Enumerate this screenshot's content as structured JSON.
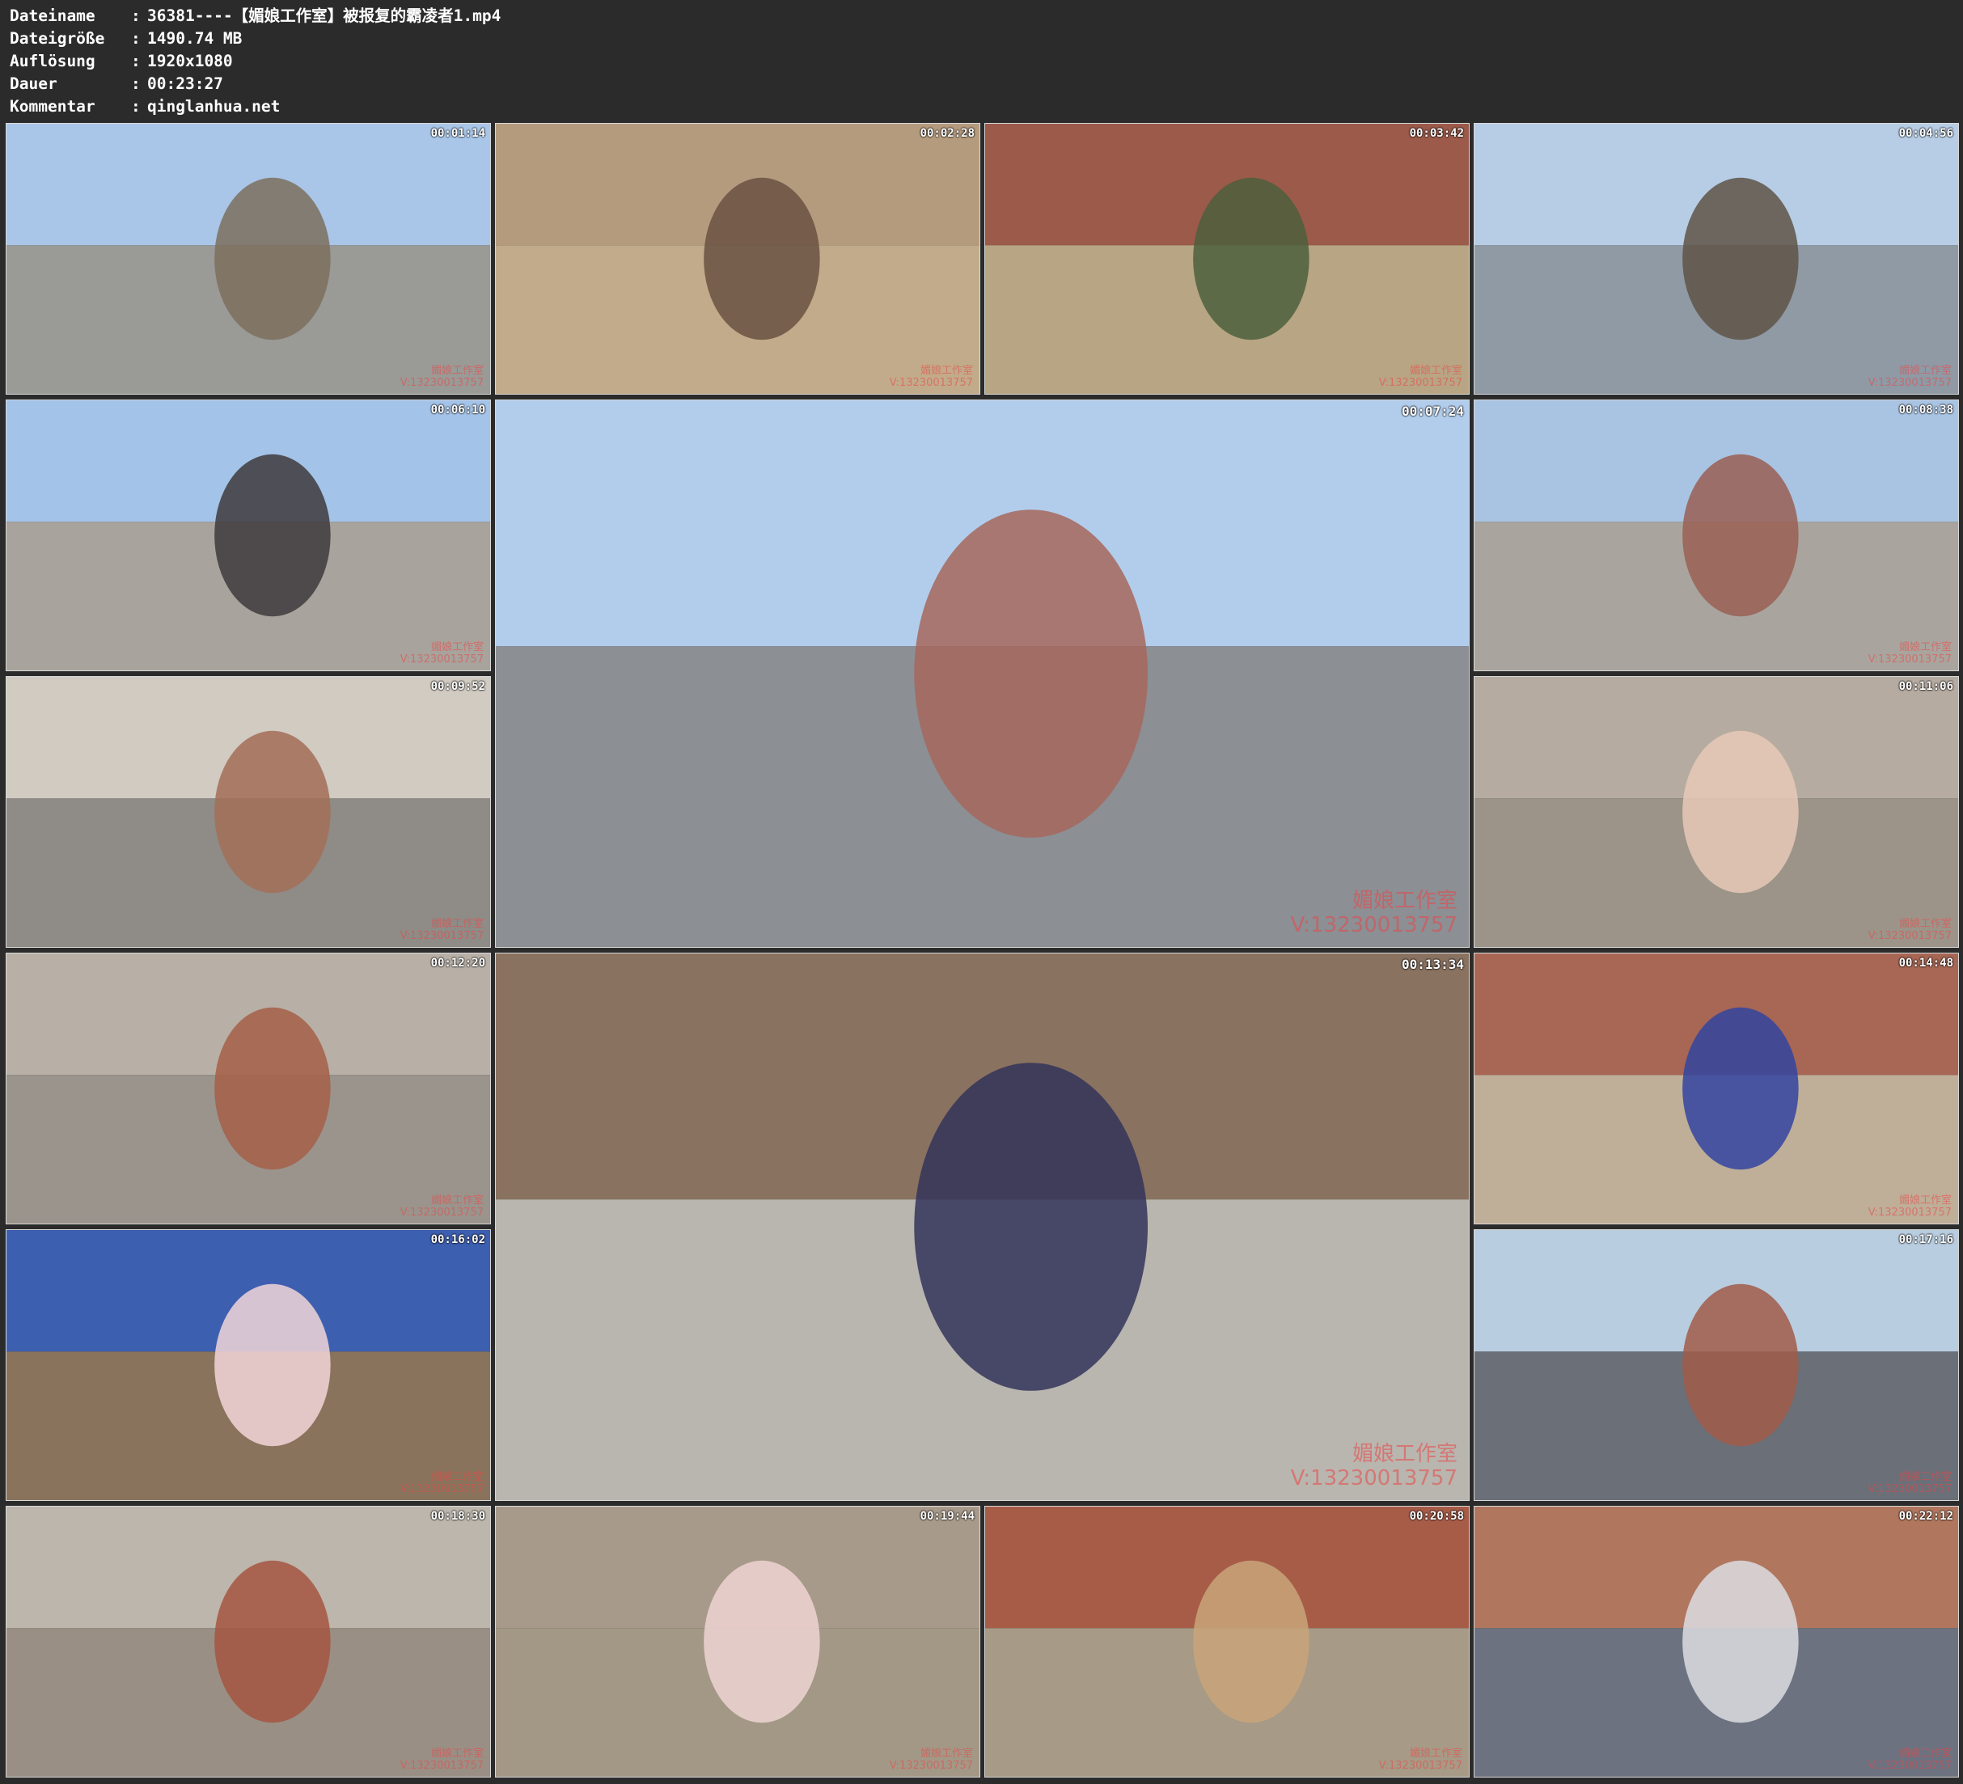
{
  "header": {
    "rows": [
      {
        "label": "Dateiname",
        "value": "36381----【媚娘工作室】被报复的霸凌者1.mp4"
      },
      {
        "label": "Dateigröße",
        "value": "1490.74 MB"
      },
      {
        "label": "Auflösung",
        "value": "1920x1080"
      },
      {
        "label": "Dauer",
        "value": "00:23:27"
      },
      {
        "label": "Kommentar",
        "value": "qinglanhua.net"
      }
    ]
  },
  "watermark": {
    "line1": "媚娘工作室",
    "line2": "V:13230013757"
  },
  "tiles": [
    {
      "timestamp": "00:01:14",
      "sky": "#a9c6e8",
      "ground": "#9a9a96",
      "accent": "#7d6f5e"
    },
    {
      "timestamp": "00:02:28",
      "sky": "#b59b7e",
      "ground": "#c2ab8a",
      "accent": "#6a5142"
    },
    {
      "timestamp": "00:03:42",
      "sky": "#9c5a4a",
      "ground": "#b8a584",
      "accent": "#4c5f3c"
    },
    {
      "timestamp": "00:04:56",
      "sky": "#b7cde6",
      "ground": "#8f9aa5",
      "accent": "#5f5447"
    },
    {
      "timestamp": "00:06:10",
      "sky": "#a4c3e8",
      "ground": "#a8a39c",
      "accent": "#3e3a3c"
    },
    {
      "timestamp": "00:07:24",
      "sky": "#b2cdec",
      "ground": "#8c8f94",
      "accent": "#a6675d"
    },
    {
      "timestamp": "00:08:38",
      "sky": "#a9c4e3",
      "ground": "#a9a59e",
      "accent": "#9a5f53"
    },
    {
      "timestamp": "00:09:52",
      "sky": "#d1cbc2",
      "ground": "#8f8b86",
      "accent": "#a36e57"
    },
    {
      "timestamp": "00:11:06",
      "sky": "#b6aba0",
      "ground": "#9c9489",
      "accent": "#e7c9b7"
    },
    {
      "timestamp": "00:12:20",
      "sky": "#b8b0a6",
      "ground": "#9a948d",
      "accent": "#a55f48"
    },
    {
      "timestamp": "00:13:34",
      "sky": "#8a7260",
      "ground": "#b9b6af",
      "accent": "#33345a"
    },
    {
      "timestamp": "00:14:48",
      "sky": "#a86654",
      "ground": "#bfae98",
      "accent": "#3344a0"
    },
    {
      "timestamp": "00:16:02",
      "sky": "#3d5fb0",
      "ground": "#8a735c",
      "accent": "#f2d6d8"
    },
    {
      "timestamp": "00:17:16",
      "sky": "#b9cde0",
      "ground": "#6b6f78",
      "accent": "#a05c48"
    },
    {
      "timestamp": "00:18:30",
      "sky": "#bdb6ac",
      "ground": "#9a8f85",
      "accent": "#a55641"
    },
    {
      "timestamp": "00:19:44",
      "sky": "#a89a8a",
      "ground": "#a39886",
      "accent": "#efd3d2"
    },
    {
      "timestamp": "00:20:58",
      "sky": "#a75c48",
      "ground": "#a79a86",
      "accent": "#c9a57a"
    },
    {
      "timestamp": "00:22:12",
      "sky": "#b0765e",
      "ground": "#6d7280",
      "accent": "#dcdde2"
    }
  ]
}
